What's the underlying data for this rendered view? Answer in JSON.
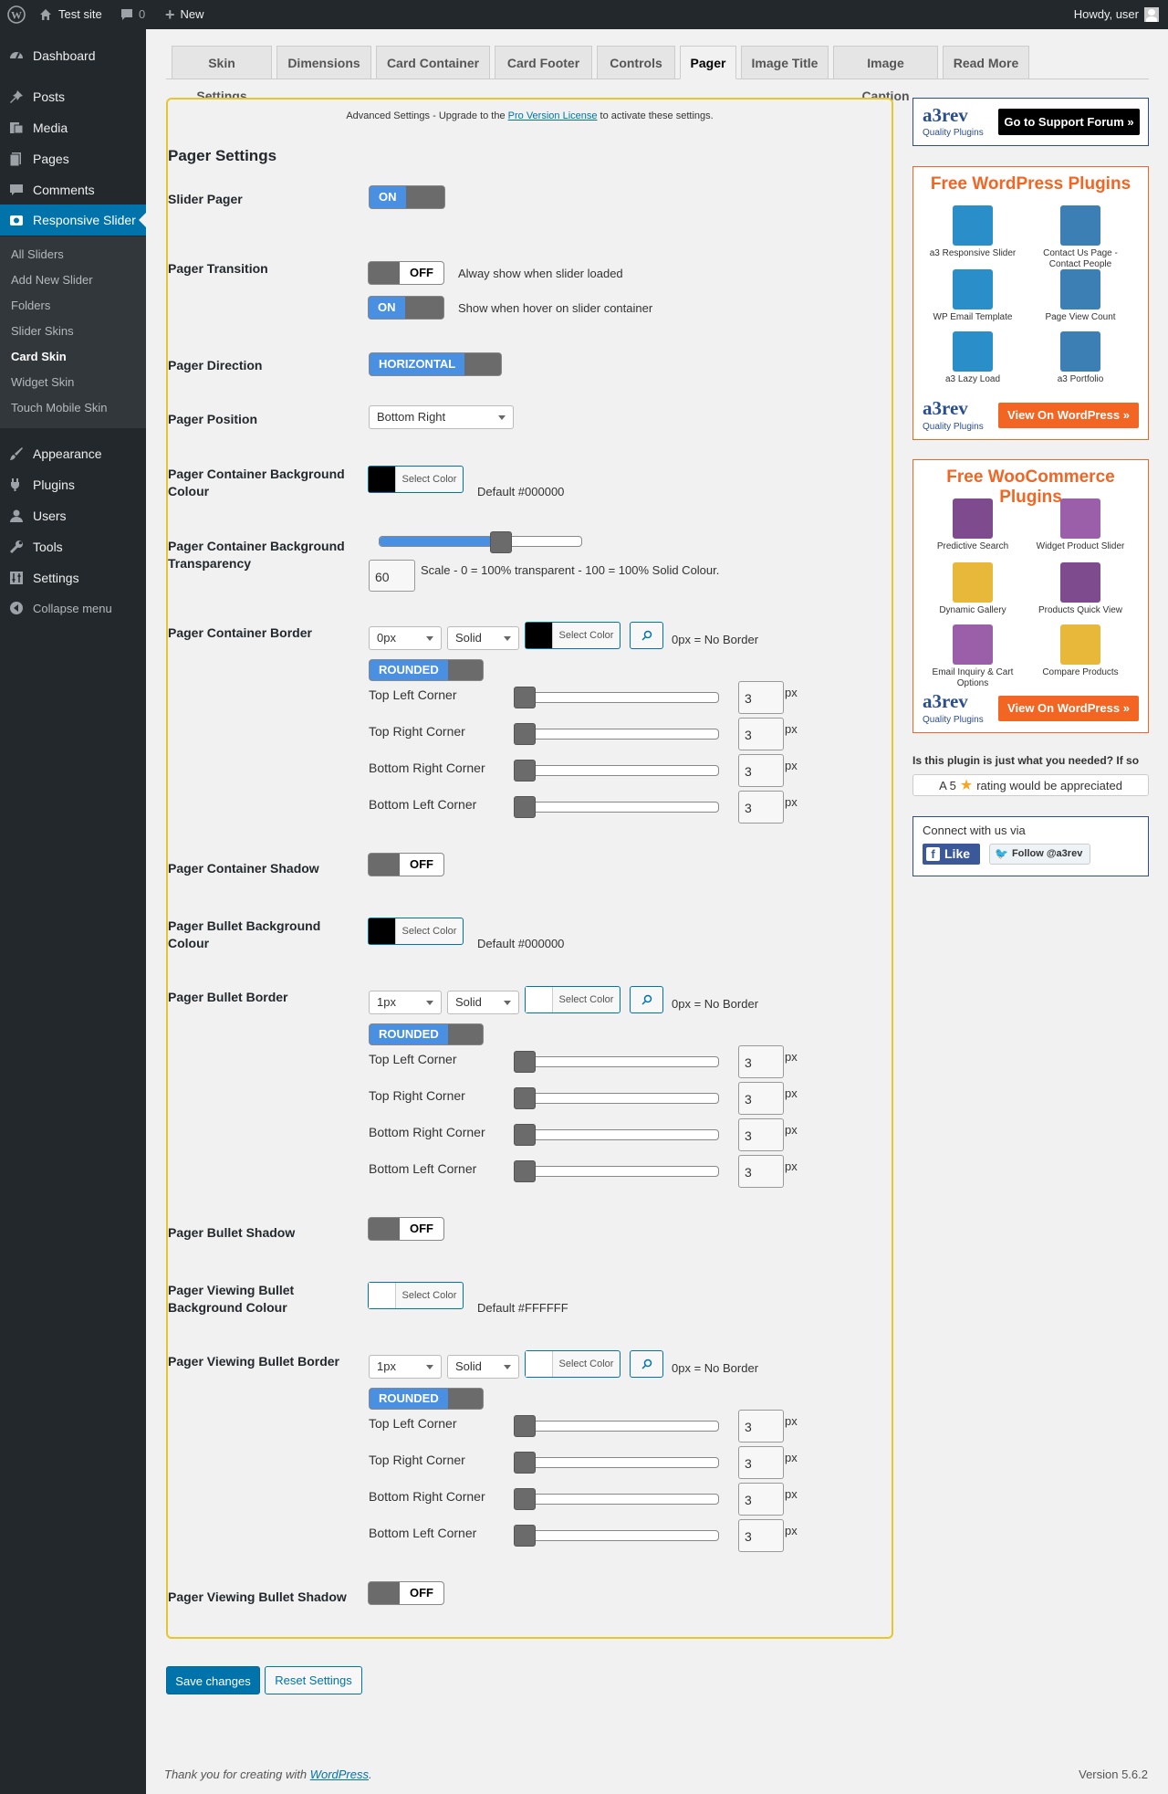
{
  "admin_bar": {
    "site_name": "Test site",
    "comments_count": "0",
    "new_label": "New",
    "howdy": "Howdy, user"
  },
  "sidebar": {
    "items": [
      {
        "label": "Dashboard",
        "icon": "dashboard-icon"
      },
      {
        "label": "Posts",
        "icon": "pin-icon"
      },
      {
        "label": "Media",
        "icon": "media-icon"
      },
      {
        "label": "Pages",
        "icon": "page-icon"
      },
      {
        "label": "Comments",
        "icon": "comment-icon"
      },
      {
        "label": "Responsive Slider",
        "icon": "camera-icon"
      }
    ],
    "submenu": [
      "All Sliders",
      "Add New Slider",
      "Folders",
      "Slider Skins",
      "Card Skin",
      "Widget Skin",
      "Touch Mobile Skin"
    ],
    "items2": [
      {
        "label": "Appearance",
        "icon": "brush-icon"
      },
      {
        "label": "Plugins",
        "icon": "plug-icon"
      },
      {
        "label": "Users",
        "icon": "users-icon"
      },
      {
        "label": "Tools",
        "icon": "wrench-icon"
      },
      {
        "label": "Settings",
        "icon": "settings-icon"
      },
      {
        "label": "Collapse menu",
        "icon": "collapse-icon"
      }
    ]
  },
  "tabs": [
    "Skin Settings",
    "Dimensions",
    "Card Container",
    "Card Footer",
    "Controls",
    "Pager",
    "Image Title",
    "Image Caption",
    "Read More"
  ],
  "notice": {
    "prefix": "Advanced Settings - Upgrade to the ",
    "link": "Pro Version License",
    "suffix": " to activate these settings."
  },
  "section_title": "Pager Settings",
  "fields": {
    "slider_pager": {
      "label": "Slider Pager",
      "toggle": "ON"
    },
    "transition": {
      "label": "Pager Transition",
      "opt1_toggle": "OFF",
      "opt1_desc": "Alway show when slider loaded",
      "opt2_toggle": "ON",
      "opt2_desc": "Show when hover on slider container"
    },
    "direction": {
      "label": "Pager Direction",
      "toggle": "HORIZONTAL"
    },
    "position": {
      "label": "Pager Position",
      "value": "Bottom Right"
    },
    "container_bg": {
      "label": "Pager Container Background Colour",
      "button": "Select Color",
      "default": "Default #000000",
      "swatch": "#000000"
    },
    "container_transparency": {
      "label": "Pager Container Background Transparency",
      "value": "60",
      "level": 60,
      "desc": "Scale - 0 = 100% transparent - 100 = 100% Solid Colour."
    },
    "container_border": {
      "label": "Pager Container Border",
      "width": "0px",
      "style": "Solid",
      "button": "Select Color",
      "swatch": "#000000",
      "note": "0px = No Border",
      "rounded": "ROUNDED"
    },
    "container_shadow": {
      "label": "Pager Container Shadow",
      "toggle": "OFF"
    },
    "bullet_bg": {
      "label": "Pager Bullet Background Colour",
      "button": "Select Color",
      "default": "Default #000000",
      "swatch": "#000000"
    },
    "bullet_border": {
      "label": "Pager Bullet Border",
      "width": "1px",
      "style": "Solid",
      "button": "Select Color",
      "swatch": "#ffffff",
      "note": "0px = No Border",
      "rounded": "ROUNDED"
    },
    "bullet_shadow": {
      "label": "Pager Bullet Shadow",
      "toggle": "OFF"
    },
    "viewing_bg": {
      "label": "Pager Viewing Bullet Background Colour",
      "button": "Select Color",
      "default": "Default #FFFFFF",
      "swatch": "#ffffff"
    },
    "viewing_border": {
      "label": "Pager Viewing Bullet Border",
      "width": "1px",
      "style": "Solid",
      "button": "Select Color",
      "swatch": "#ffffff",
      "note": "0px = No Border",
      "rounded": "ROUNDED"
    },
    "viewing_shadow": {
      "label": "Pager Viewing Bullet Shadow",
      "toggle": "OFF"
    }
  },
  "corners": {
    "labels": [
      "Top Left Corner",
      "Top Right Corner",
      "Bottom Right Corner",
      "Bottom Left Corner"
    ],
    "value": "3",
    "unit": "px"
  },
  "buttons": {
    "save": "Save changes",
    "reset": "Reset Settings"
  },
  "footer": {
    "prefix": "Thank you for creating with ",
    "link": "WordPress",
    "suffix": ".",
    "version": "Version 5.6.2"
  },
  "right": {
    "support_button": "Go to Support Forum",
    "a3_logo": "a3rev",
    "a3_sub": "Quality Plugins",
    "wp_title": "Free WordPress Plugins",
    "wp_plugins": [
      "a3 Responsive Slider",
      "Contact Us Page - Contact People",
      "WP Email Template",
      "Page View Count",
      "a3 Lazy Load",
      "a3 Portfolio"
    ],
    "woo_title": "Free WooCommerce Plugins",
    "woo_plugins": [
      "Predictive Search",
      "Widget Product Slider",
      "Dynamic Gallery",
      "Products Quick View",
      "Email Inquiry & Cart Options",
      "Compare Products"
    ],
    "view_button": "View On WordPress",
    "rating_q": "Is this plugin is just what you needed? If so",
    "rating_pre": "A 5",
    "rating_post": "rating would be appreciated",
    "connect": "Connect with us via",
    "like": "Like",
    "follow": "Follow @a3rev"
  },
  "colors": {
    "accent": "#0073aa",
    "toggle_on": "#4a90e2",
    "panel_border": "#e6c62e",
    "orange": "#f26522"
  }
}
